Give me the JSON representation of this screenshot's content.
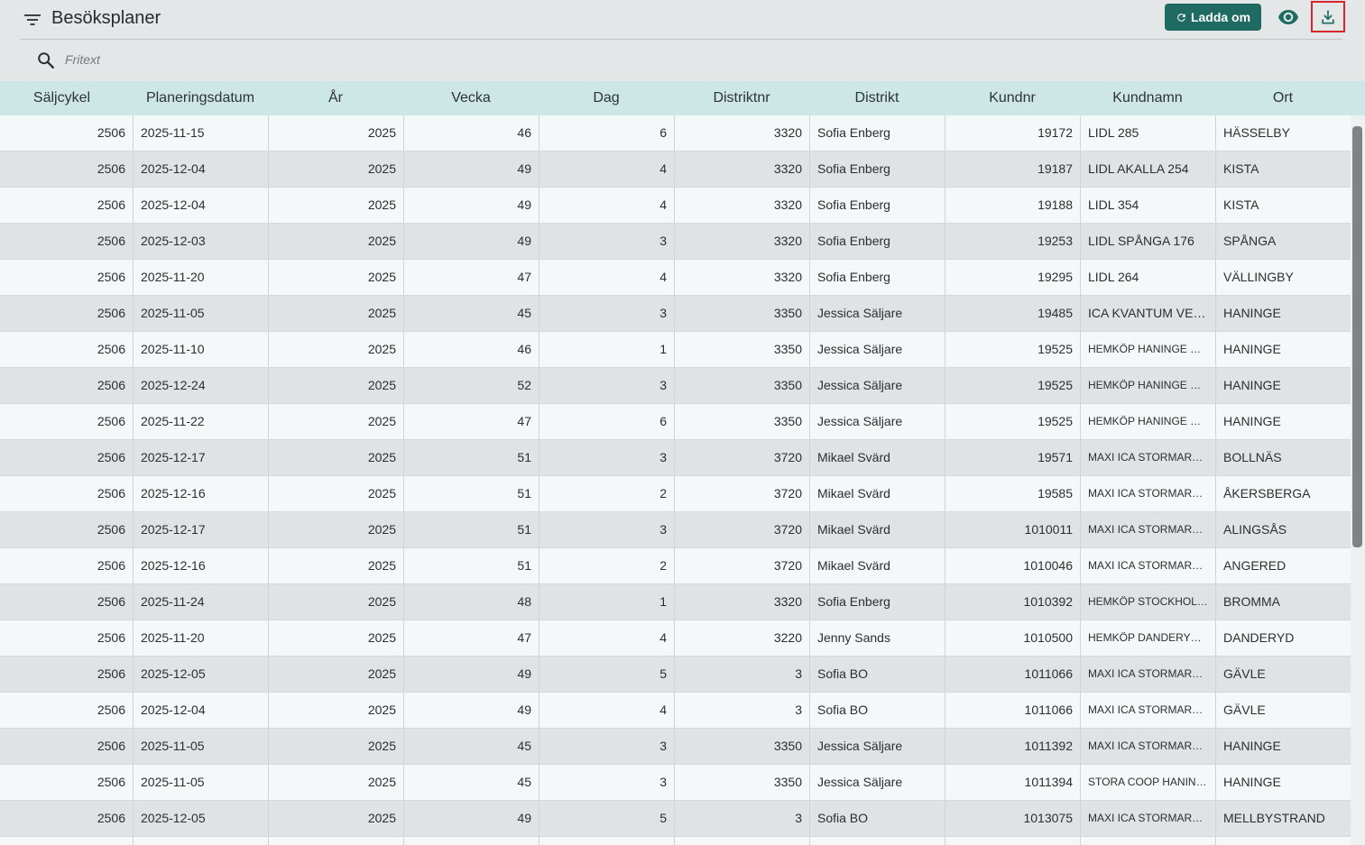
{
  "header": {
    "title": "Besöksplaner",
    "reload_label": "Ladda om",
    "search_placeholder": "Fritext"
  },
  "icons": {
    "filter": "filter-icon",
    "reload": "refresh-icon",
    "eye": "eye-icon",
    "download": "download-icon",
    "search": "search-icon"
  },
  "colors": {
    "accent": "#1f6b62",
    "header_bg": "#cde6e6",
    "highlight_border": "#d8262b"
  },
  "table": {
    "columns": [
      "Säljcykel",
      "Planeringsdatum",
      "År",
      "Vecka",
      "Dag",
      "Distriktnr",
      "Distrikt",
      "Kundnr",
      "Kundnamn",
      "Ort"
    ],
    "rows": [
      [
        "2506",
        "2025-11-15",
        "2025",
        "46",
        "6",
        "3320",
        "Sofia Enberg",
        "19172",
        "LIDL 285",
        "HÄSSELBY"
      ],
      [
        "2506",
        "2025-12-04",
        "2025",
        "49",
        "4",
        "3320",
        "Sofia Enberg",
        "19187",
        "LIDL AKALLA 254",
        "KISTA"
      ],
      [
        "2506",
        "2025-12-04",
        "2025",
        "49",
        "4",
        "3320",
        "Sofia Enberg",
        "19188",
        "LIDL 354",
        "KISTA"
      ],
      [
        "2506",
        "2025-12-03",
        "2025",
        "49",
        "3",
        "3320",
        "Sofia Enberg",
        "19253",
        "LIDL SPÅNGA 176",
        "SPÅNGA"
      ],
      [
        "2506",
        "2025-11-20",
        "2025",
        "47",
        "4",
        "3320",
        "Sofia Enberg",
        "19295",
        "LIDL 264",
        "VÄLLINGBY"
      ],
      [
        "2506",
        "2025-11-05",
        "2025",
        "45",
        "3",
        "3350",
        "Jessica Säljare",
        "19485",
        "ICA KVANTUM VEGA",
        "HANINGE"
      ],
      [
        "2506",
        "2025-11-10",
        "2025",
        "46",
        "1",
        "3350",
        "Jessica Säljare",
        "19525",
        "HEMKÖP HANINGE VE...",
        "HANINGE"
      ],
      [
        "2506",
        "2025-12-24",
        "2025",
        "52",
        "3",
        "3350",
        "Jessica Säljare",
        "19525",
        "HEMKÖP HANINGE VE...",
        "HANINGE"
      ],
      [
        "2506",
        "2025-11-22",
        "2025",
        "47",
        "6",
        "3350",
        "Jessica Säljare",
        "19525",
        "HEMKÖP HANINGE VE...",
        "HANINGE"
      ],
      [
        "2506",
        "2025-12-17",
        "2025",
        "51",
        "3",
        "3720",
        "Mikael Svärd",
        "19571",
        "MAXI ICA STORMARK...",
        "BOLLNÄS"
      ],
      [
        "2506",
        "2025-12-16",
        "2025",
        "51",
        "2",
        "3720",
        "Mikael Svärd",
        "19585",
        "MAXI ICA STORMARK...",
        "ÅKERSBERGA"
      ],
      [
        "2506",
        "2025-12-17",
        "2025",
        "51",
        "3",
        "3720",
        "Mikael Svärd",
        "1010011",
        "MAXI ICA STORMARK...",
        "ALINGSÅS"
      ],
      [
        "2506",
        "2025-12-16",
        "2025",
        "51",
        "2",
        "3720",
        "Mikael Svärd",
        "1010046",
        "MAXI ICA STORMARK...",
        "ANGERED"
      ],
      [
        "2506",
        "2025-11-24",
        "2025",
        "48",
        "1",
        "3320",
        "Sofia Enberg",
        "1010392",
        "HEMKÖP STOCKHOLM...",
        "BROMMA"
      ],
      [
        "2506",
        "2025-11-20",
        "2025",
        "47",
        "4",
        "3220",
        "Jenny Sands",
        "1010500",
        "HEMKÖP DANDERYD ...",
        "DANDERYD"
      ],
      [
        "2506",
        "2025-12-05",
        "2025",
        "49",
        "5",
        "3",
        "Sofia BO",
        "1011066",
        "MAXI ICA STORMARK...",
        "GÄVLE"
      ],
      [
        "2506",
        "2025-12-04",
        "2025",
        "49",
        "4",
        "3",
        "Sofia BO",
        "1011066",
        "MAXI ICA STORMARK...",
        "GÄVLE"
      ],
      [
        "2506",
        "2025-11-05",
        "2025",
        "45",
        "3",
        "3350",
        "Jessica Säljare",
        "1011392",
        "MAXI ICA STORMARK...",
        "HANINGE"
      ],
      [
        "2506",
        "2025-11-05",
        "2025",
        "45",
        "3",
        "3350",
        "Jessica Säljare",
        "1011394",
        "STORA COOP HANING...",
        "HANINGE"
      ],
      [
        "2506",
        "2025-12-05",
        "2025",
        "49",
        "5",
        "3",
        "Sofia BO",
        "1013075",
        "MAXI ICA STORMARK...",
        "MELLBYSTRAND"
      ],
      [
        "",
        "",
        "",
        "",
        "",
        "",
        "",
        "",
        "",
        ""
      ]
    ]
  }
}
